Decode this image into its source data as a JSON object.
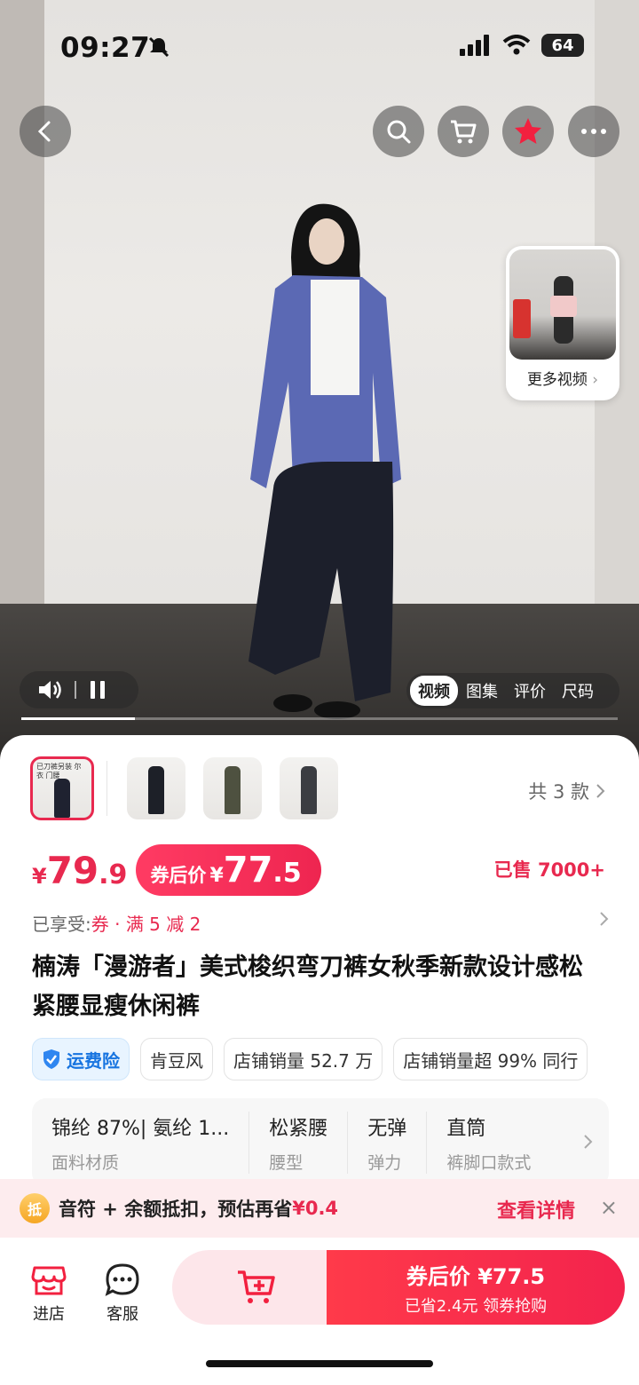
{
  "status_bar": {
    "time": "09:27",
    "battery": "64"
  },
  "top_nav": {
    "icons": [
      "back-icon",
      "search-icon",
      "cart-icon",
      "favorite-star-icon",
      "more-icon"
    ]
  },
  "video": {
    "more_videos_label": "更多视频",
    "media_tabs": [
      "视频",
      "图集",
      "评价",
      "尺码"
    ],
    "active_tab": "视频",
    "progress": 0.19
  },
  "variants": {
    "count_label": "共 3 款",
    "selected_thumb_text": "已刀裤另装 尔衣 门腰"
  },
  "price": {
    "currency": "¥",
    "original_int": "79",
    "original_dec": ".9",
    "coupon_label": "券后价",
    "coupon_int": "77",
    "coupon_dec": ".5",
    "sold": "已售 7000+"
  },
  "enjoy": {
    "label": "已享受:",
    "value": "券 · 满 5 减 2"
  },
  "product": {
    "title": "楠涛「漫游者」美式梭织弯刀裤女秋季新款设计感松紧腰显瘦休闲裤"
  },
  "tags": [
    "运费险",
    "肯豆风",
    "店铺销量 52.7 万",
    "店铺销量超 99% 同行"
  ],
  "attributes": [
    {
      "value": "锦纶 87%| 氨纶 1...",
      "key": "面料材质"
    },
    {
      "value": "松紧腰",
      "key": "腰型"
    },
    {
      "value": "无弹",
      "key": "弹力"
    },
    {
      "value": "直筒",
      "key": "裤脚口款式"
    }
  ],
  "promo": {
    "badge": "抵",
    "text": "音符 + 余额抵扣，预估再省",
    "amount": "¥0.4",
    "detail": "查看详情",
    "close": "×"
  },
  "bottom_bar": {
    "store_label": "进店",
    "service_label": "客服",
    "buy_line1": "券后价 ¥77.5",
    "buy_line2": "已省2.4元   领券抢购"
  },
  "colors": {
    "accent": "#e8294f",
    "insure_blue": "#1774e0",
    "promo_bg": "#fdecee"
  }
}
